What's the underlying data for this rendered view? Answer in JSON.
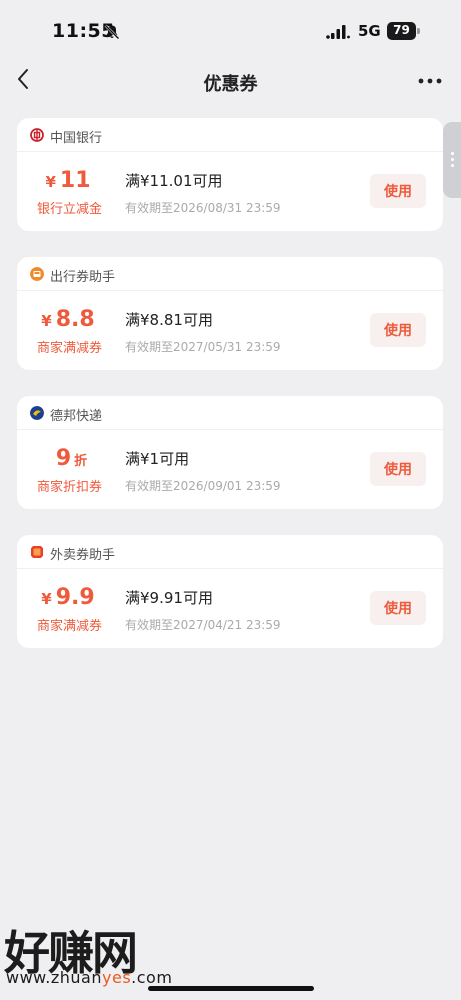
{
  "status_bar": {
    "time": "11:55",
    "network": "5G",
    "battery": "79",
    "icons": [
      "bell-slash-icon",
      "signal-icon",
      "battery-icon"
    ]
  },
  "nav": {
    "title": "优惠券",
    "icons": [
      "chevron-left-icon",
      "more-icon"
    ]
  },
  "coupons": [
    {
      "merchant": "中国银行",
      "logo_color": "#c8202a",
      "currency": "¥",
      "amount": "11",
      "unit": "",
      "type": "银行立减金",
      "condition": "满¥11.01可用",
      "expiry": "有效期至2026/08/31 23:59",
      "button": "使用"
    },
    {
      "merchant": "出行券助手",
      "logo_color": "#f08a2a",
      "currency": "¥",
      "amount": "8.8",
      "unit": "",
      "type": "商家满减券",
      "condition": "满¥8.81可用",
      "expiry": "有效期至2027/05/31 23:59",
      "button": "使用"
    },
    {
      "merchant": "德邦快递",
      "logo_color": "#1c3f8f",
      "currency": "",
      "amount": "9",
      "unit": "折",
      "type": "商家折扣券",
      "condition": "满¥1可用",
      "expiry": "有效期至2026/09/01 23:59",
      "button": "使用"
    },
    {
      "merchant": "外卖券助手",
      "logo_color": "#e8402a",
      "currency": "¥",
      "amount": "9.9",
      "unit": "",
      "type": "商家满减券",
      "condition": "满¥9.91可用",
      "expiry": "有效期至2027/04/21 23:59",
      "button": "使用"
    }
  ],
  "watermark": {
    "big": "好赚网",
    "url_pre": "www.zhuan",
    "url_hl": "yes",
    "url_post": ".com"
  },
  "colors": {
    "accent": "#ee5a3c",
    "background": "#efeff2"
  }
}
